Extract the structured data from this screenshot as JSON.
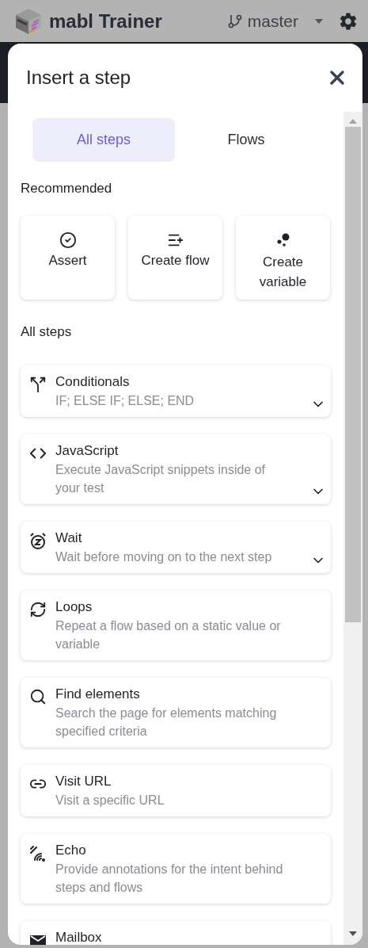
{
  "app_header": {
    "title": "mabl Trainer",
    "branch": "master"
  },
  "dialog": {
    "title": "Insert a step",
    "tabs": [
      {
        "label": "All steps",
        "selected": true
      },
      {
        "label": "Flows",
        "selected": false
      }
    ],
    "recommended": {
      "heading": "Recommended",
      "items": [
        {
          "kind": "assert",
          "label": "Assert"
        },
        {
          "kind": "flow",
          "label": "Create flow"
        },
        {
          "kind": "variable",
          "label": "Create variable"
        }
      ]
    },
    "all_steps": {
      "heading": "All steps",
      "items": [
        {
          "kind": "conditionals",
          "title": "Conditionals",
          "description": "IF; ELSE IF; ELSE; END",
          "expandable": true
        },
        {
          "kind": "javascript",
          "title": "JavaScript",
          "description": "Execute JavaScript snippets inside of your test",
          "expandable": true
        },
        {
          "kind": "wait",
          "title": "Wait",
          "description": "Wait before moving on to the next step",
          "expandable": true
        },
        {
          "kind": "loops",
          "title": "Loops",
          "description": "Repeat a flow based on a static value or variable",
          "expandable": false
        },
        {
          "kind": "find",
          "title": "Find elements",
          "description": "Search the page for elements matching specified criteria",
          "expandable": false
        },
        {
          "kind": "visit",
          "title": "Visit URL",
          "description": "Visit a specific URL",
          "expandable": false
        },
        {
          "kind": "echo",
          "title": "Echo",
          "description": "Provide annotations for the intent behind steps and flows",
          "expandable": false
        },
        {
          "kind": "mailbox",
          "title": "Mailbox",
          "expandable": false
        }
      ]
    }
  }
}
